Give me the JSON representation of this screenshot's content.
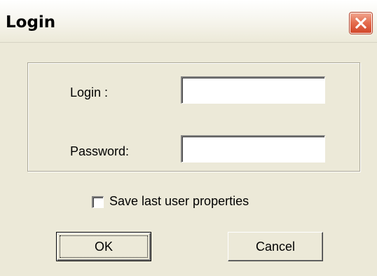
{
  "window": {
    "title": "Login",
    "close_icon": "close-icon"
  },
  "form": {
    "login_label": "Login :",
    "login_value": "",
    "password_label": "Password:",
    "password_value": "",
    "save_properties_label": "Save last user properties",
    "save_properties_checked": false
  },
  "buttons": {
    "ok_label": "OK",
    "cancel_label": "Cancel"
  },
  "colors": {
    "dialog_bg": "#ece9d8",
    "close_button": "#e46b4c"
  }
}
